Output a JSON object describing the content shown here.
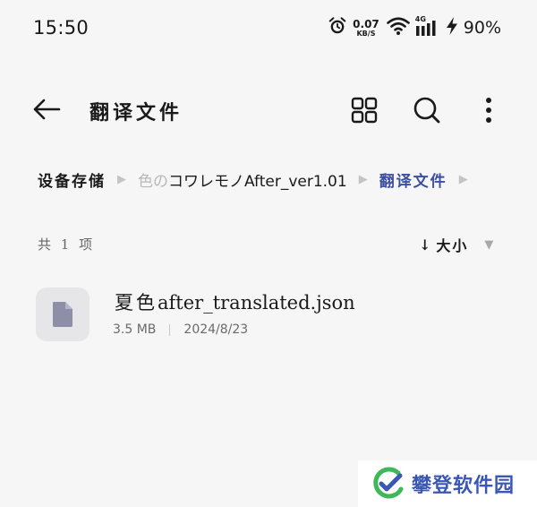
{
  "status_bar": {
    "time": "15:50",
    "speed_value": "0.07",
    "speed_unit": "KB/S",
    "network_type": "4G",
    "battery": "90%",
    "icons": [
      "alarm-icon",
      "wifi-icon",
      "signal-icon",
      "charging-icon"
    ]
  },
  "app_bar": {
    "title": "翻译文件",
    "icons": [
      "back-arrow-icon",
      "grid-view-icon",
      "search-icon",
      "more-vert-icon"
    ]
  },
  "breadcrumb": {
    "items": [
      {
        "label": "设备存储"
      },
      {
        "label_faded": "色の",
        "label": "コワレモノAfter_ver1.01"
      },
      {
        "label": "翻译文件"
      }
    ]
  },
  "list_header": {
    "count_label": "共 1 项",
    "sort_label": "大小",
    "sort_direction_icon": "↓"
  },
  "files": [
    {
      "name_prefix": "夏色",
      "name_suffix": "after_translated.json",
      "size": "3.5 MB",
      "date": "2024/8/23",
      "icon": "document-icon"
    }
  ],
  "watermark": {
    "text": "攀登软件园"
  },
  "colors": {
    "background": "#f6f6f6",
    "accent": "#3c4fa0",
    "file_icon_bg": "#e6e6e9",
    "file_icon": "#8e8ea8",
    "watermark_text": "#3b57b5"
  }
}
